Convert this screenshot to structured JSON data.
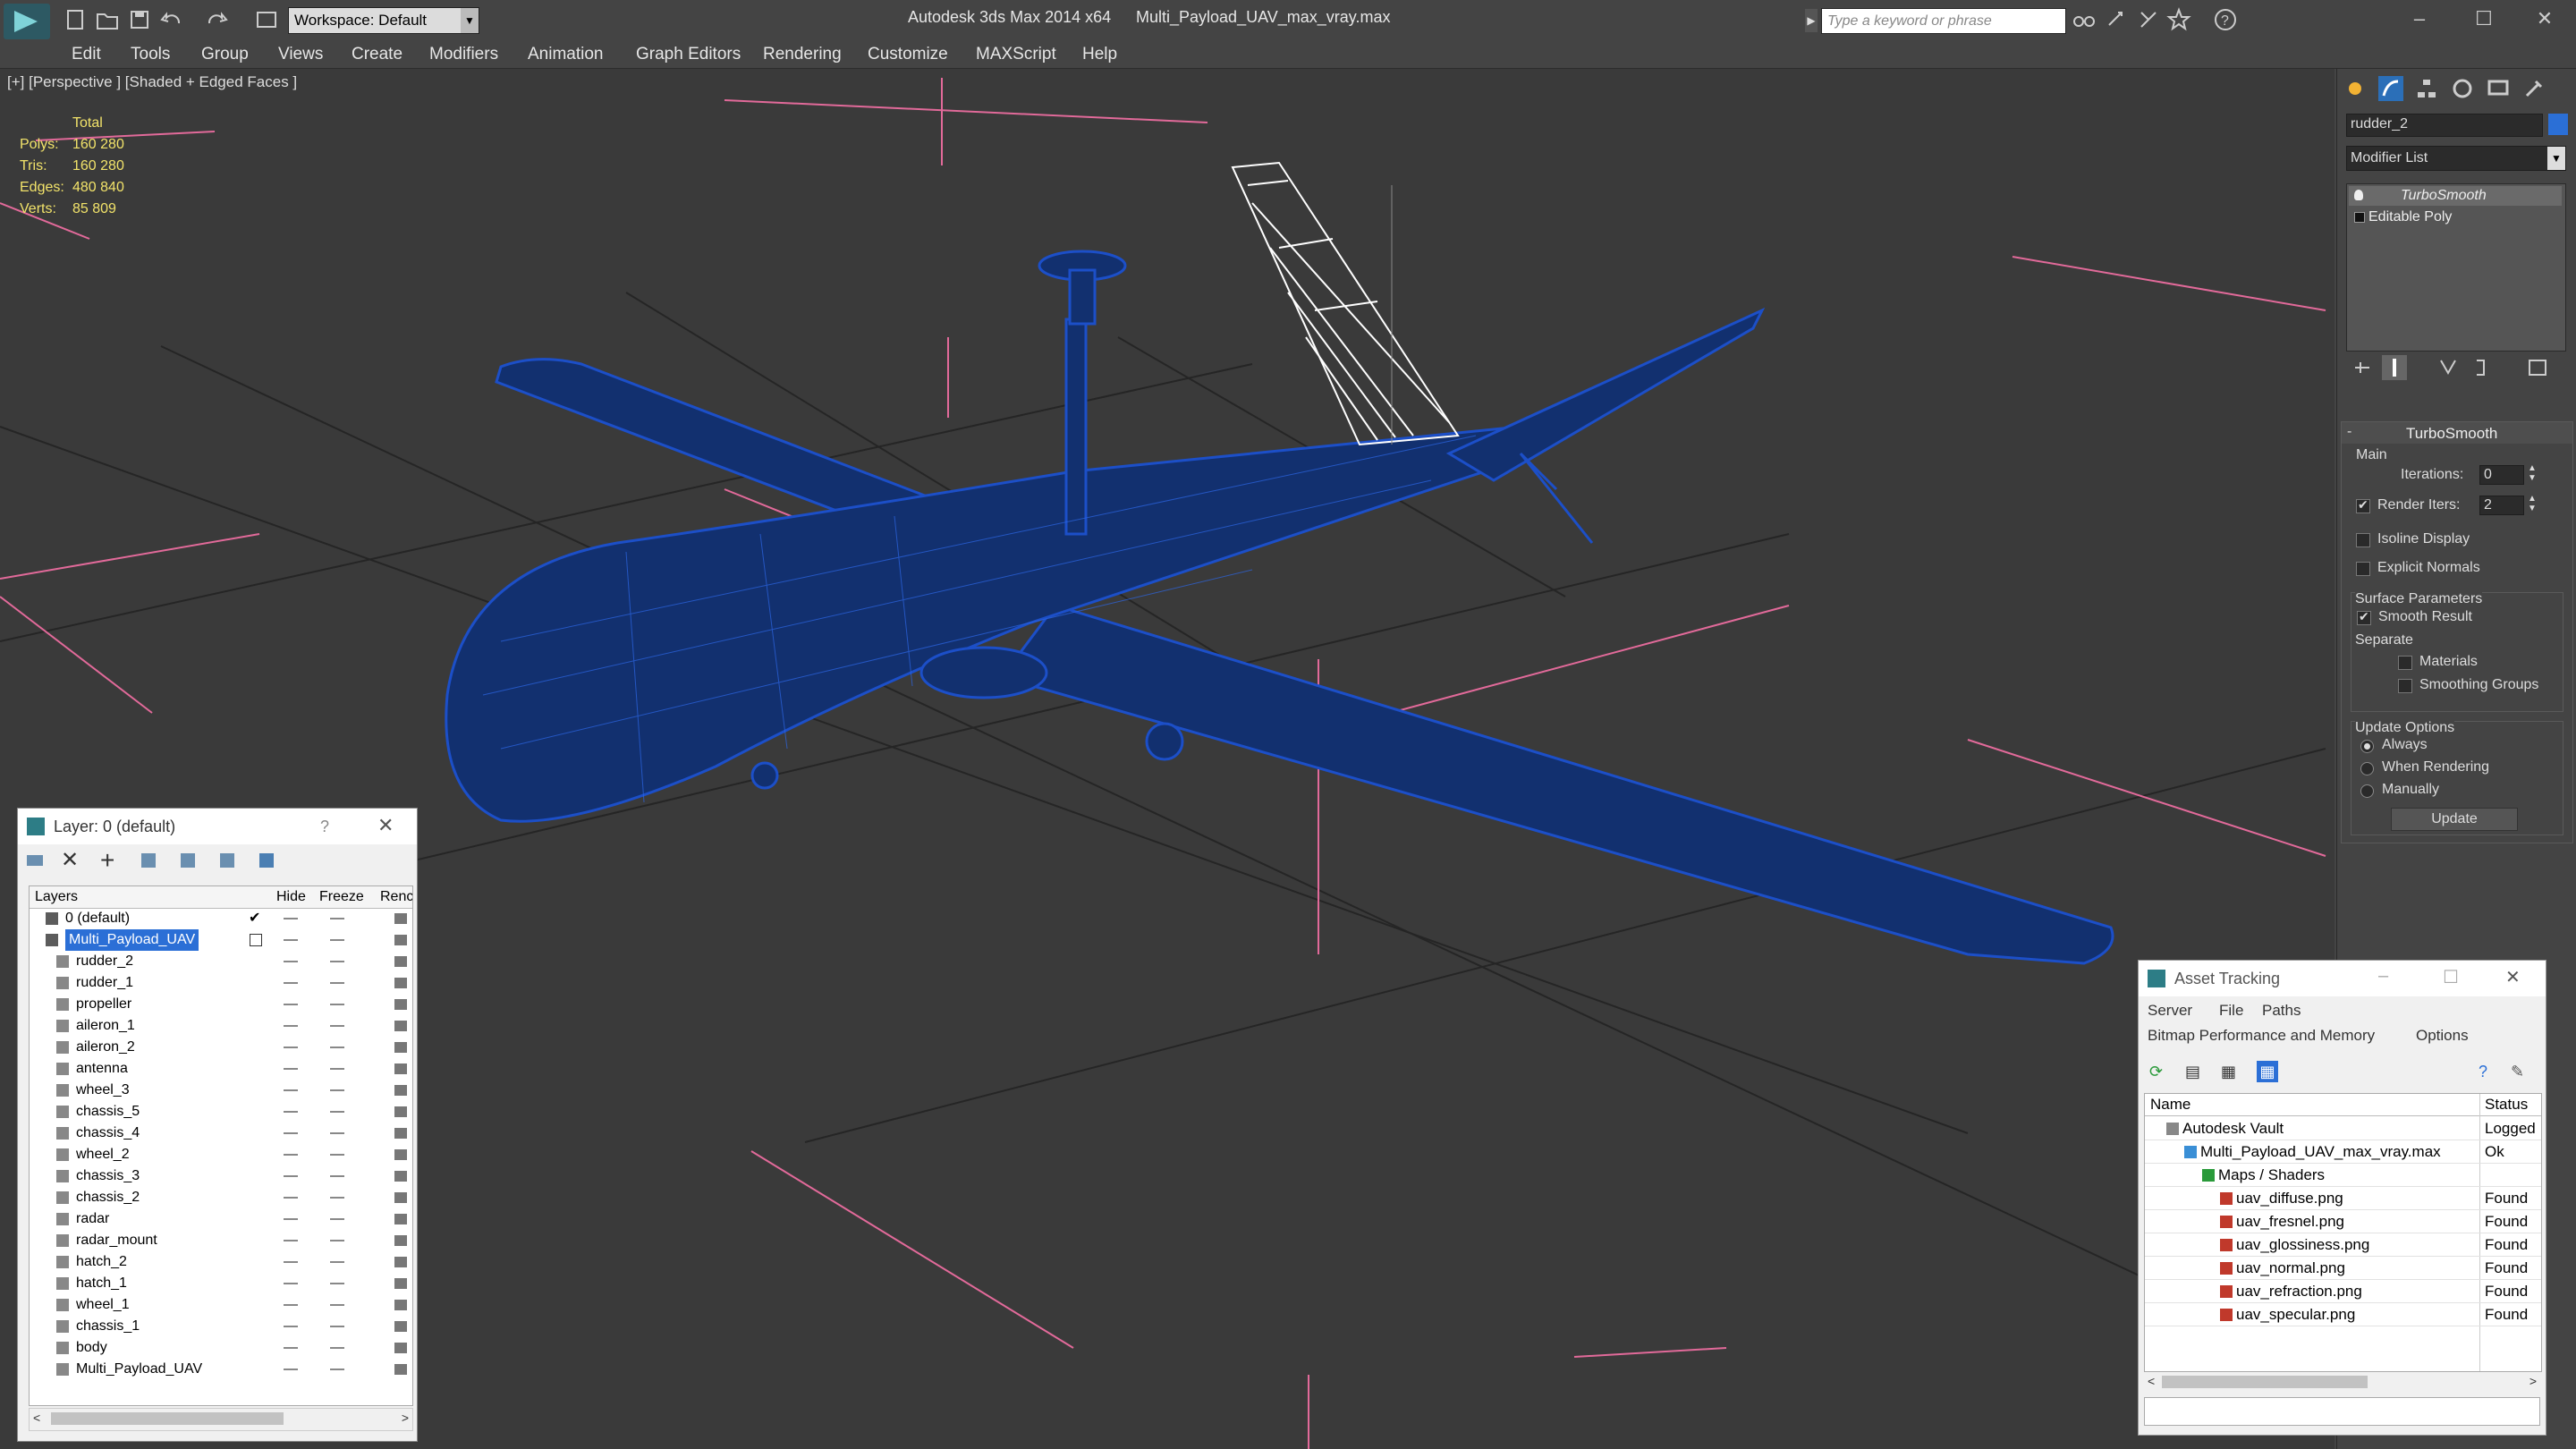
{
  "titlebar": {
    "workspace": "Workspace: Default",
    "app": "Autodesk 3ds Max  2014 x64",
    "file": "Multi_Payload_UAV_max_vray.max",
    "search_placeholder": "Type a keyword or phrase"
  },
  "menu": [
    "Edit",
    "Tools",
    "Group",
    "Views",
    "Create",
    "Modifiers",
    "Animation",
    "Graph Editors",
    "Rendering",
    "Customize",
    "MAXScript",
    "Help"
  ],
  "viewport": {
    "label": "[+] [Perspective ] [Shaded + Edged Faces ]",
    "stats": {
      "header": "Total",
      "rows": [
        {
          "k": "Polys:",
          "v": "160 280"
        },
        {
          "k": "Tris:",
          "v": "160 280"
        },
        {
          "k": "Edges:",
          "v": "480 840"
        },
        {
          "k": "Verts:",
          "v": "85 809"
        }
      ]
    },
    "colors": {
      "bg": "#3a3a3a",
      "grid": "#1f1f1f",
      "wire": "#1c4fc8",
      "selected": "#ffffff",
      "accent": "#e26a9a"
    }
  },
  "command_panel": {
    "object_name": "rudder_2",
    "modifier_list": "Modifier List",
    "stack": [
      "TurboSmooth",
      "Editable Poly"
    ],
    "rollout_title": "TurboSmooth",
    "main_label": "Main",
    "iterations_label": "Iterations:",
    "iterations_value": "0",
    "render_iters_label": "Render Iters:",
    "render_iters_value": "2",
    "isoline": "Isoline Display",
    "explicit": "Explicit Normals",
    "surface_params": "Surface Parameters",
    "smooth_result": "Smooth Result",
    "separate": "Separate",
    "materials": "Materials",
    "smoothing_groups": "Smoothing Groups",
    "update_options": "Update Options",
    "always": "Always",
    "when_rendering": "When Rendering",
    "manually": "Manually",
    "update_btn": "Update"
  },
  "layer_window": {
    "title": "Layer: 0 (default)",
    "help": "?",
    "columns": [
      "Layers",
      "Hide",
      "Freeze",
      "Renc"
    ],
    "layers": [
      {
        "name": "0 (default)",
        "level": 0
      },
      {
        "name": "Multi_Payload_UAV",
        "level": 0,
        "selected": true
      },
      {
        "name": "rudder_2",
        "level": 1
      },
      {
        "name": "rudder_1",
        "level": 1
      },
      {
        "name": "propeller",
        "level": 1
      },
      {
        "name": "aileron_1",
        "level": 1
      },
      {
        "name": "aileron_2",
        "level": 1
      },
      {
        "name": "antenna",
        "level": 1
      },
      {
        "name": "wheel_3",
        "level": 1
      },
      {
        "name": "chassis_5",
        "level": 1
      },
      {
        "name": "chassis_4",
        "level": 1
      },
      {
        "name": "wheel_2",
        "level": 1
      },
      {
        "name": "chassis_3",
        "level": 1
      },
      {
        "name": "chassis_2",
        "level": 1
      },
      {
        "name": "radar",
        "level": 1
      },
      {
        "name": "radar_mount",
        "level": 1
      },
      {
        "name": "hatch_2",
        "level": 1
      },
      {
        "name": "hatch_1",
        "level": 1
      },
      {
        "name": "wheel_1",
        "level": 1
      },
      {
        "name": "chassis_1",
        "level": 1
      },
      {
        "name": "body",
        "level": 1
      },
      {
        "name": "Multi_Payload_UAV",
        "level": 1
      }
    ]
  },
  "asset_window": {
    "title": "Asset Tracking",
    "menu1": [
      "Server",
      "File",
      "Paths"
    ],
    "menu2": [
      "Bitmap Performance and Memory",
      "Options"
    ],
    "columns": [
      "Name",
      "Status"
    ],
    "rows": [
      {
        "name": "Autodesk Vault",
        "status": "Logged",
        "indent": 0,
        "icon": "vault"
      },
      {
        "name": "Multi_Payload_UAV_max_vray.max",
        "status": "Ok",
        "indent": 1,
        "icon": "max"
      },
      {
        "name": "Maps / Shaders",
        "status": "",
        "indent": 2,
        "icon": "folder"
      },
      {
        "name": "uav_diffuse.png",
        "status": "Found",
        "indent": 3,
        "icon": "png"
      },
      {
        "name": "uav_fresnel.png",
        "status": "Found",
        "indent": 3,
        "icon": "png"
      },
      {
        "name": "uav_glossiness.png",
        "status": "Found",
        "indent": 3,
        "icon": "png"
      },
      {
        "name": "uav_normal.png",
        "status": "Found",
        "indent": 3,
        "icon": "png"
      },
      {
        "name": "uav_refraction.png",
        "status": "Found",
        "indent": 3,
        "icon": "png"
      },
      {
        "name": "uav_specular.png",
        "status": "Found",
        "indent": 3,
        "icon": "png"
      }
    ]
  }
}
